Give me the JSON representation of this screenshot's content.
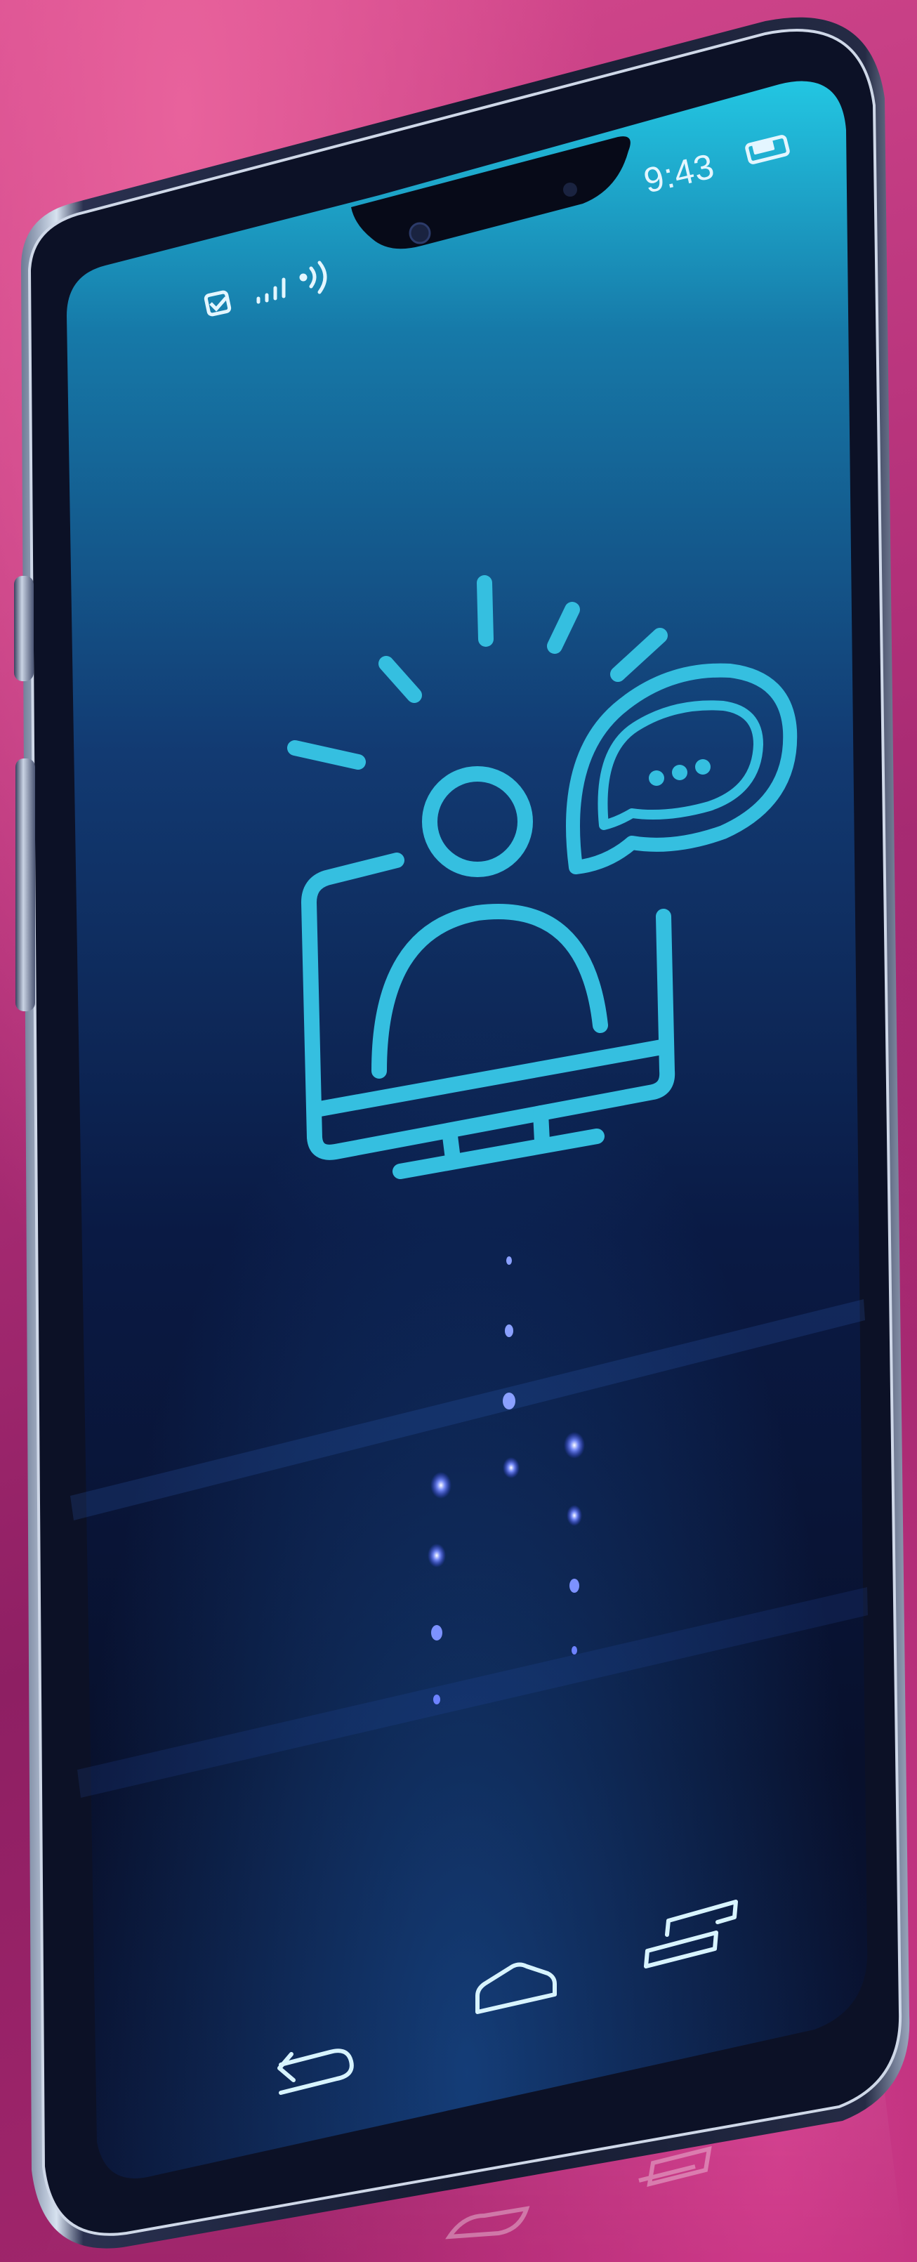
{
  "status_bar": {
    "time": "9:43",
    "icons": [
      "checkbox-icon",
      "signal-bars-icon",
      "wifi-waves-icon",
      "battery-icon"
    ]
  },
  "screen": {
    "illustration": "person-at-monitor-with-speech-bubble-icon",
    "accent_color": "#35bfe0",
    "dot_color": "#5d78ff"
  },
  "nav_bar": {
    "icons": [
      "back-arrow-icon",
      "home-icon",
      "recent-apps-icon"
    ]
  },
  "colors": {
    "background": "#b23079",
    "phone_frame": "#1b1f33",
    "screen_top": "#1fb8d8",
    "screen_bottom": "#070b1e"
  }
}
